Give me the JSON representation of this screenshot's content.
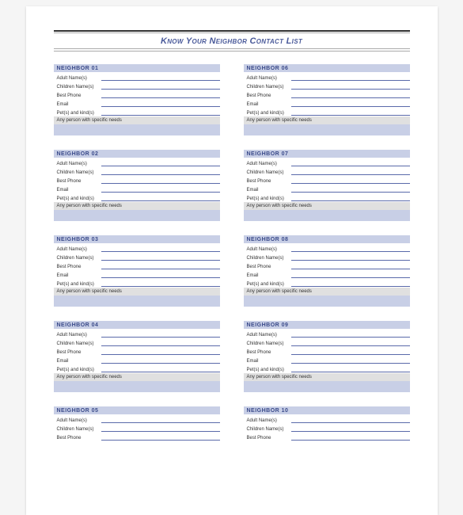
{
  "title": "Know Your Neighbor Contact List",
  "fields": {
    "adult": "Adult Name(s)",
    "children": "Children Name(s)",
    "phone": "Best Phone",
    "email": "Email",
    "pets": "Pet(s) and kind(s)",
    "needs": "Any person with specific needs"
  },
  "neighbor_prefix": "NEIGHBOR",
  "left_cards": [
    {
      "num": "01",
      "full": true
    },
    {
      "num": "02",
      "full": true
    },
    {
      "num": "03",
      "full": true
    },
    {
      "num": "04",
      "full": true
    },
    {
      "num": "05",
      "full": false
    }
  ],
  "right_cards": [
    {
      "num": "06",
      "full": true
    },
    {
      "num": "07",
      "full": true
    },
    {
      "num": "08",
      "full": true
    },
    {
      "num": "09",
      "full": true
    },
    {
      "num": "10",
      "full": false
    }
  ]
}
